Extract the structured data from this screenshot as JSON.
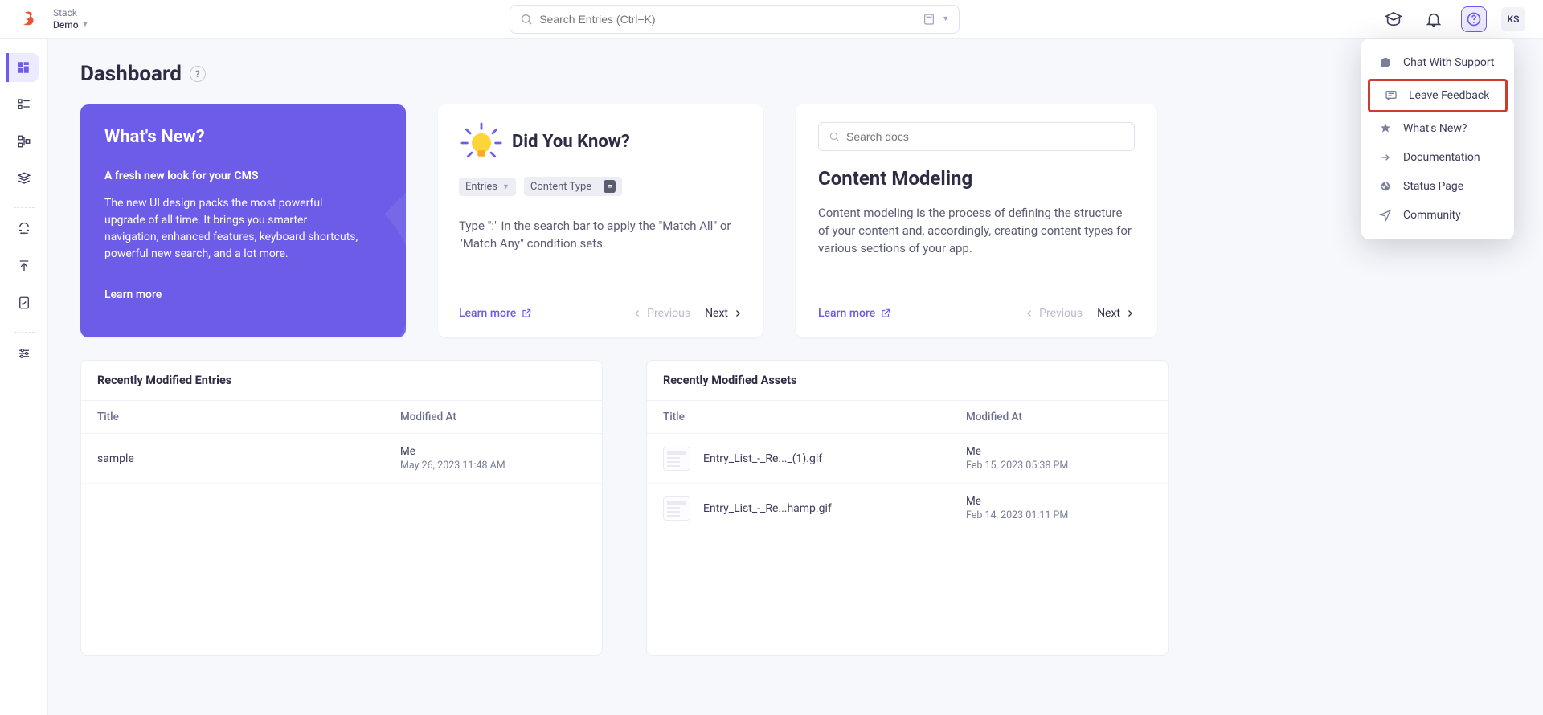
{
  "header": {
    "stack_label": "Stack",
    "stack_name": "Demo",
    "search_placeholder": "Search Entries (Ctrl+K)",
    "user_initials": "KS"
  },
  "help_menu": {
    "chat": "Chat With Support",
    "feedback": "Leave Feedback",
    "whatsnew": "What's New?",
    "docs": "Documentation",
    "status": "Status Page",
    "community": "Community"
  },
  "page": {
    "title": "Dashboard"
  },
  "card_new": {
    "title": "What's New?",
    "subtitle": "A fresh new look for your CMS",
    "body": "The new UI design packs the most powerful upgrade of all time. It brings you smarter navigation, enhanced features, keyboard shortcuts, powerful new search, and a lot more.",
    "link": "Learn more"
  },
  "card_dy": {
    "title": "Did You Know?",
    "chip_entries": "Entries",
    "chip_ct": "Content Type",
    "eq": "=",
    "body": "Type \":\" in the search bar to apply the \"Match All\" or \"Match Any\" condition sets.",
    "learn": "Learn more",
    "prev": "Previous",
    "next": "Next"
  },
  "card_docs": {
    "search_placeholder": "Search docs",
    "title": "Content Modeling",
    "body": "Content modeling is the process of defining the structure of your content and, accordingly, creating content types for various sections of your app.",
    "learn": "Learn more",
    "prev": "Previous",
    "next": "Next"
  },
  "entries_panel": {
    "title": "Recently Modified Entries",
    "col_title": "Title",
    "col_mod": "Modified At",
    "rows": [
      {
        "title": "sample",
        "by": "Me",
        "date": "May 26, 2023 11:48 AM"
      }
    ]
  },
  "assets_panel": {
    "title": "Recently Modified Assets",
    "col_title": "Title",
    "col_mod": "Modified At",
    "rows": [
      {
        "title": "Entry_List_-_Re..._(1).gif",
        "by": "Me",
        "date": "Feb 15, 2023 05:38 PM"
      },
      {
        "title": "Entry_List_-_Re...hamp.gif",
        "by": "Me",
        "date": "Feb 14, 2023 01:11 PM"
      }
    ]
  }
}
